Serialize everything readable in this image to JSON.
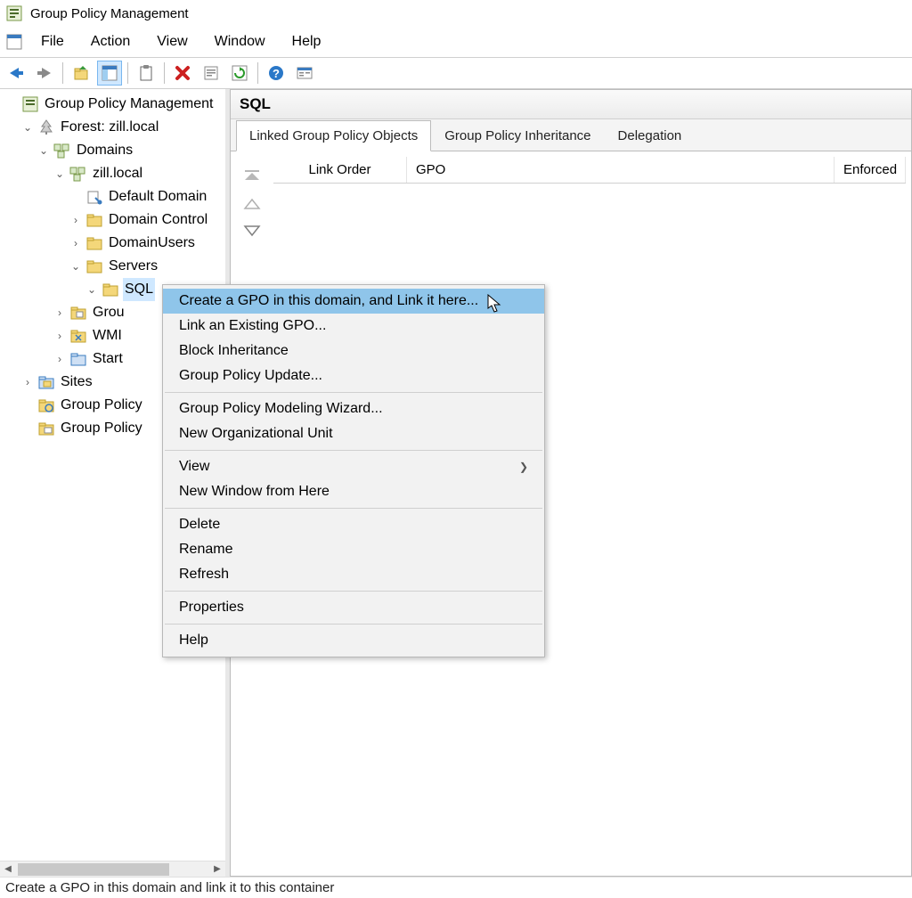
{
  "title": "Group Policy Management",
  "menu": {
    "file": "File",
    "action": "Action",
    "view": "View",
    "window": "Window",
    "help": "Help"
  },
  "tree": {
    "root": "Group Policy Management",
    "forest": "Forest: zill.local",
    "domains": "Domains",
    "zill": "zill.local",
    "default_domain": "Default Domain",
    "domain_controllers": "Domain Control",
    "domain_users": "DomainUsers",
    "servers": "Servers",
    "sql": "SQL",
    "gpo_objects": "Grou",
    "wmi": "WMI",
    "starter": "Start",
    "sites": "Sites",
    "gp_modeling": "Group Policy",
    "gp_results": "Group Policy"
  },
  "content": {
    "header": "SQL",
    "tabs": {
      "linked": "Linked Group Policy Objects",
      "inheritance": "Group Policy Inheritance",
      "delegation": "Delegation"
    },
    "columns": {
      "link_order": "Link Order",
      "gpo": "GPO",
      "enforced": "Enforced"
    }
  },
  "context_menu": {
    "create_gpo": "Create a GPO in this domain, and Link it here...",
    "link_existing": "Link an Existing GPO...",
    "block_inheritance": "Block Inheritance",
    "gp_update": "Group Policy Update...",
    "gpm_wizard": "Group Policy Modeling Wizard...",
    "new_ou": "New Organizational Unit",
    "view": "View",
    "new_window": "New Window from Here",
    "delete": "Delete",
    "rename": "Rename",
    "refresh": "Refresh",
    "properties": "Properties",
    "help": "Help"
  },
  "status": "Create a GPO in this domain and link it to this container"
}
